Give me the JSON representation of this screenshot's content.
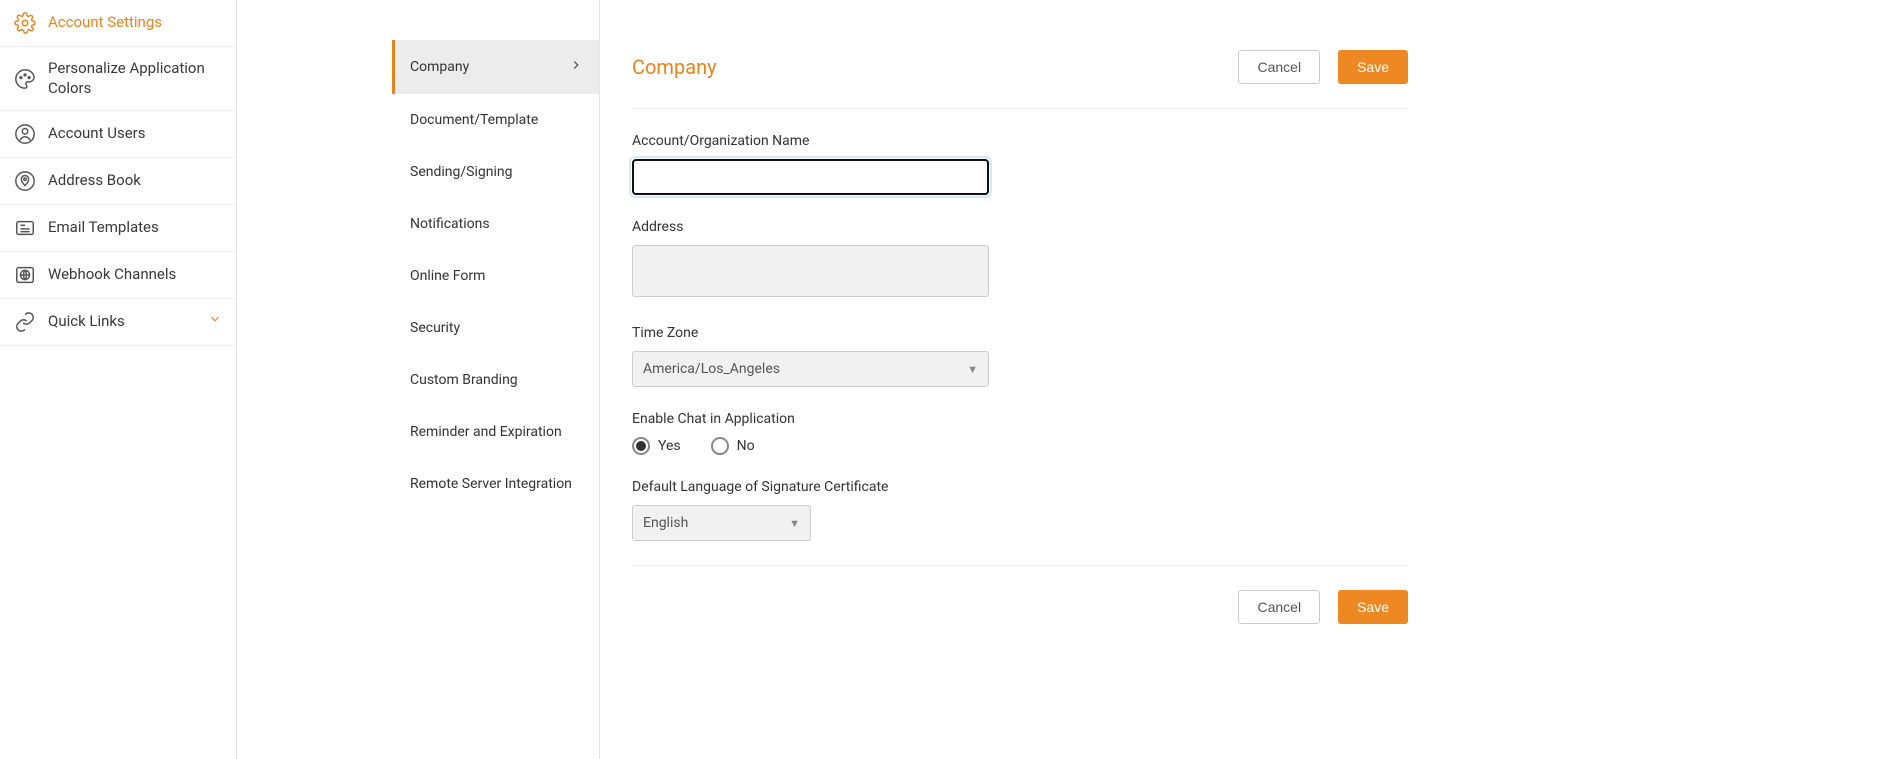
{
  "leftNav": {
    "items": [
      {
        "label": "Account Settings",
        "icon": "gear-icon",
        "active": true
      },
      {
        "label": "Personalize Application Colors",
        "icon": "palette-icon"
      },
      {
        "label": "Account Users",
        "icon": "user-icon"
      },
      {
        "label": "Address Book",
        "icon": "pin-icon"
      },
      {
        "label": "Email Templates",
        "icon": "mail-template-icon"
      },
      {
        "label": "Webhook Channels",
        "icon": "globe-icon"
      },
      {
        "label": "Quick Links",
        "icon": "link-icon",
        "expandable": true
      }
    ]
  },
  "subNav": {
    "items": [
      {
        "label": "Company",
        "active": true
      },
      {
        "label": "Document/Template"
      },
      {
        "label": "Sending/Signing"
      },
      {
        "label": "Notifications"
      },
      {
        "label": "Online Form"
      },
      {
        "label": "Security"
      },
      {
        "label": "Custom Branding"
      },
      {
        "label": "Reminder and Expiration"
      },
      {
        "label": "Remote Server Integration"
      }
    ]
  },
  "page": {
    "title": "Company",
    "cancel": "Cancel",
    "save": "Save"
  },
  "form": {
    "orgName": {
      "label": "Account/Organization Name",
      "value": ""
    },
    "address": {
      "label": "Address",
      "value": ""
    },
    "timezone": {
      "label": "Time Zone",
      "value": "America/Los_Angeles"
    },
    "chat": {
      "label": "Enable Chat in Application",
      "yes": "Yes",
      "no": "No",
      "value": "Yes"
    },
    "lang": {
      "label": "Default Language of Signature Certificate",
      "value": "English"
    }
  }
}
